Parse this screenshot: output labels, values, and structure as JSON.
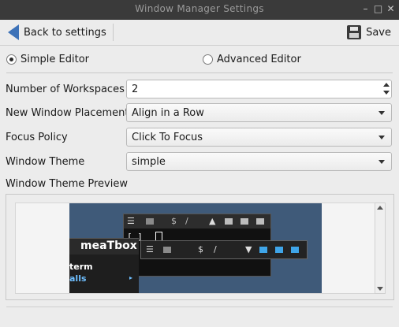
{
  "window": {
    "title": "Window Manager Settings"
  },
  "toolbar": {
    "back_label": "Back to settings",
    "save_label": "Save"
  },
  "editor_mode": {
    "simple_label": "Simple Editor",
    "advanced_label": "Advanced Editor",
    "selected": "simple"
  },
  "settings": {
    "workspaces": {
      "label": "Number of Workspaces",
      "value": "2"
    },
    "placement": {
      "label": "New Window Placement",
      "value": "Align in a Row"
    },
    "focus": {
      "label": "Focus Policy",
      "value": "Click To Focus"
    },
    "theme": {
      "label": "Window Theme",
      "value": "simple"
    }
  },
  "preview": {
    "label": "Window Theme Preview",
    "menu_title": "meaTbox",
    "menu_items": [
      "term",
      "alls"
    ],
    "titlebar_glyphs": [
      "$",
      "/"
    ],
    "colors": {
      "desktop": "#3f5a79",
      "accent_blue": "#3fa5e8",
      "menu_text": "#6fbfff"
    }
  },
  "colors": {
    "accent": "#3d72b8",
    "titlebar": "#3a3a3a",
    "window_bg": "#ececec"
  }
}
